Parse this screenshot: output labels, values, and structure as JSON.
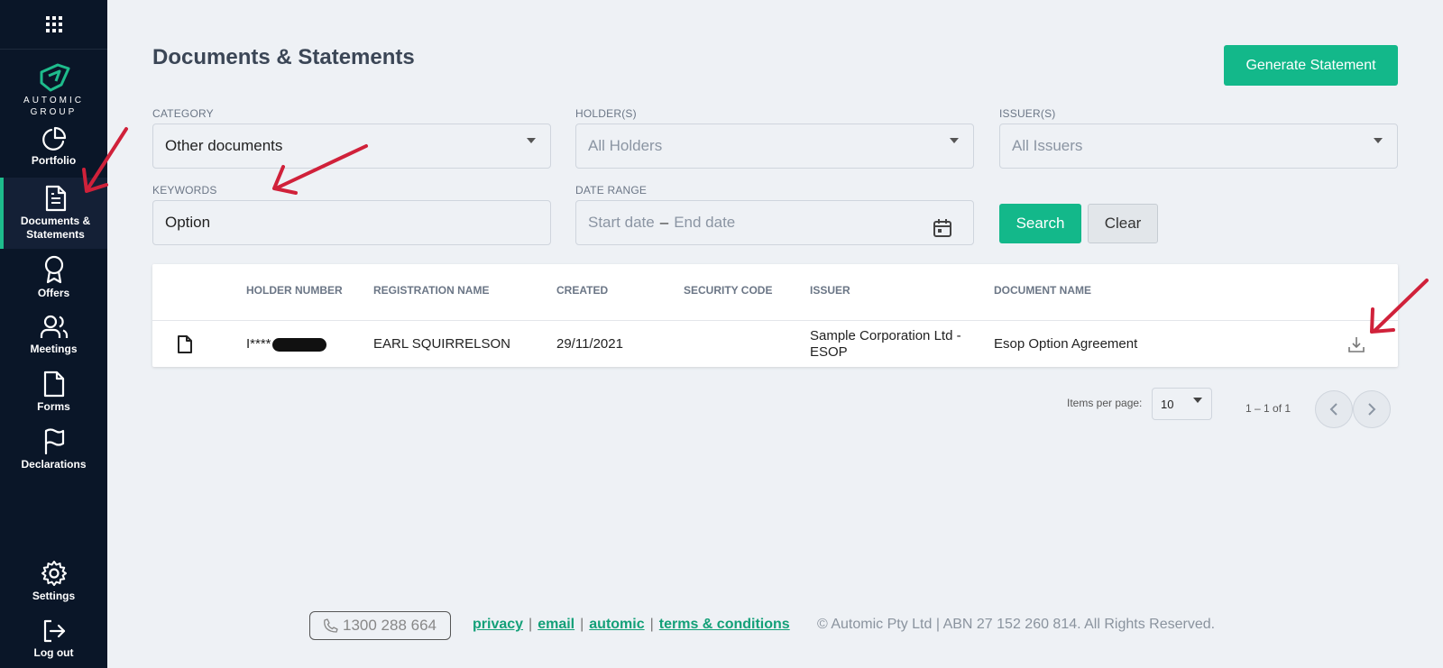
{
  "sidebar": {
    "logo_line1": "AUTOMIC",
    "logo_line2": "GROUP",
    "items": [
      {
        "label": "Portfolio",
        "icon": "pie-chart-icon"
      },
      {
        "label": "Documents & Statements",
        "icon": "document-icon",
        "active": true
      },
      {
        "label": "Offers",
        "icon": "award-icon"
      },
      {
        "label": "Meetings",
        "icon": "users-icon"
      },
      {
        "label": "Forms",
        "icon": "file-icon"
      },
      {
        "label": "Declarations",
        "icon": "flag-icon"
      },
      {
        "label": "Settings",
        "icon": "gear-icon"
      },
      {
        "label": "Log out",
        "icon": "logout-icon"
      }
    ]
  },
  "header": {
    "title": "Documents & Statements",
    "generate_button": "Generate Statement"
  },
  "filters": {
    "category": {
      "label": "CATEGORY",
      "value": "Other documents"
    },
    "holders": {
      "label": "HOLDER(S)",
      "placeholder": "All Holders"
    },
    "issuers": {
      "label": "ISSUER(S)",
      "placeholder": "All Issuers"
    },
    "keywords": {
      "label": "KEYWORDS",
      "value": "Option"
    },
    "date_range": {
      "label": "DATE RANGE",
      "start_placeholder": "Start date",
      "separator": "–",
      "end_placeholder": "End date"
    },
    "search_button": "Search",
    "clear_button": "Clear"
  },
  "table": {
    "columns": [
      "HOLDER NUMBER",
      "REGISTRATION NAME",
      "CREATED",
      "SECURITY CODE",
      "ISSUER",
      "DOCUMENT NAME"
    ],
    "rows": [
      {
        "holder_number": "I****",
        "registration_name": "EARL SQUIRRELSON",
        "created": "29/11/2021",
        "security_code": "",
        "issuer_line1": "Sample Corporation Ltd -",
        "issuer_line2": "ESOP",
        "document_name": "Esop Option Agreement"
      }
    ]
  },
  "pagination": {
    "items_per_page_label": "Items per page:",
    "items_per_page": "10",
    "range": "1 – 1 of 1"
  },
  "footer": {
    "phone": "1300 288 664",
    "links": [
      "privacy",
      "email",
      "automic",
      "terms & conditions"
    ],
    "separator": "|",
    "copyright": "© Automic Pty Ltd | ABN 27 152 260 814. All Rights Reserved."
  },
  "colors": {
    "sidebar_bg": "#0a1628",
    "accent_green": "#13b88a",
    "annotation_red": "#d0213a",
    "page_bg": "#eef1f5"
  }
}
